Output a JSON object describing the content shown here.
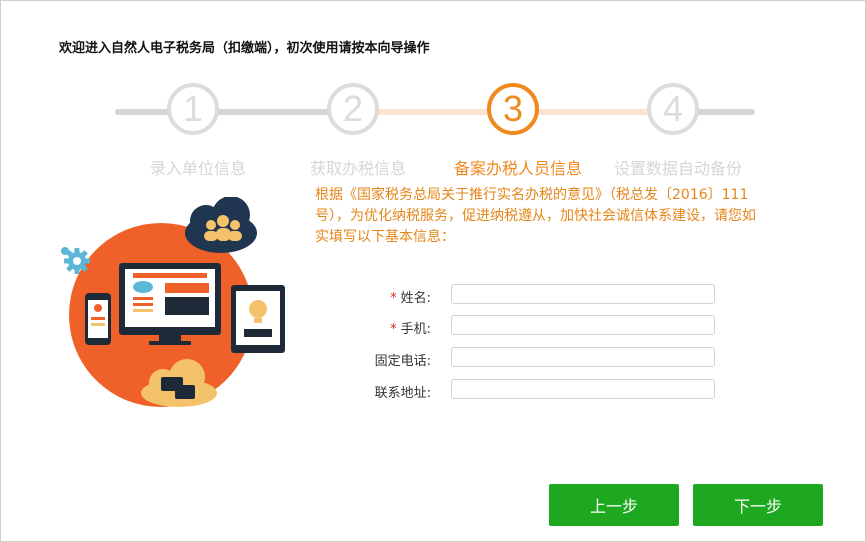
{
  "header": {
    "title": "欢迎进入自然人电子税务局（扣缴端），初次使用请按本向导操作"
  },
  "colors": {
    "active": "#ef8a1e",
    "inactive": "#dcdcdc",
    "button": "#1ea81f",
    "required": "#d9272e"
  },
  "steps": [
    {
      "number": "1",
      "label": "录入单位信息",
      "state": "done"
    },
    {
      "number": "2",
      "label": "获取办税信息",
      "state": "done"
    },
    {
      "number": "3",
      "label": "备案办税人员信息",
      "state": "current"
    },
    {
      "number": "4",
      "label": "设置数据自动备份",
      "state": "todo"
    }
  ],
  "intro": {
    "text": "根据《国家税务总局关于推行实名办税的意见》（税总发〔2016〕111号），为优化纳税服务，促进纳税遵从，加快社会诚信体系建设，请您如实填写以下基本信息："
  },
  "form": {
    "required_mark": "*",
    "fields": [
      {
        "label": "姓名:",
        "required": true,
        "value": "",
        "placeholder": ""
      },
      {
        "label": "手机:",
        "required": true,
        "value": "",
        "placeholder": ""
      },
      {
        "label": "固定电话:",
        "required": false,
        "value": "",
        "placeholder": ""
      },
      {
        "label": "联系地址:",
        "required": false,
        "value": "",
        "placeholder": ""
      }
    ]
  },
  "buttons": {
    "prev_label": "上一步",
    "next_label": "下一步"
  },
  "illustration": {
    "icons": [
      "gear-icon",
      "cloud-users-icon",
      "monitor-icon",
      "phone-icon",
      "tablet-lightbulb-icon",
      "chat-bubbles-icon"
    ]
  }
}
